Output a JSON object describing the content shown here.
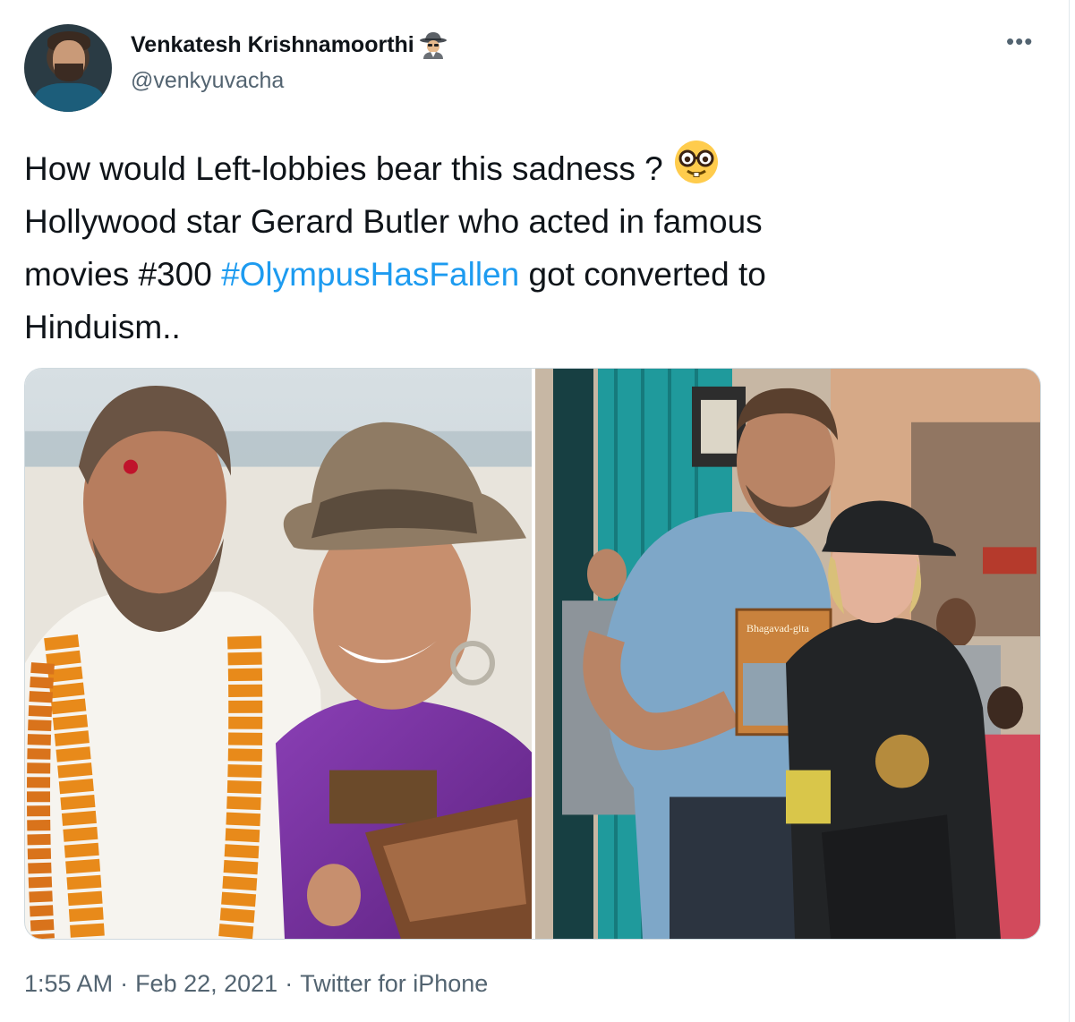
{
  "tweet": {
    "display_name": "Venkatesh Krishnamoorthi",
    "handle": "@venkyuvacha",
    "name_icon": "sleuth-spy-icon",
    "more_label": "•••",
    "text_line1": "How would Left-lobbies bear this sadness ?",
    "text_emoji": "nerd-face-icon",
    "text_line2": "Hollywood star Gerard Butler who acted in famous",
    "text_line3_pre": "movies #300",
    "hashtag": "#OlympusHasFallen",
    "text_line3_post": "got converted to",
    "text_line4": "Hinduism..",
    "time": "1:55 AM",
    "separator": "·",
    "date": "Feb 22, 2021",
    "source": "Twitter for iPhone"
  },
  "colors": {
    "link": "#1d9bf0",
    "secondary_text": "#536471",
    "primary_text": "#0f1419",
    "border": "#cfd9de"
  },
  "media": {
    "count": 2,
    "book_title": "Bhagavad-gita"
  }
}
